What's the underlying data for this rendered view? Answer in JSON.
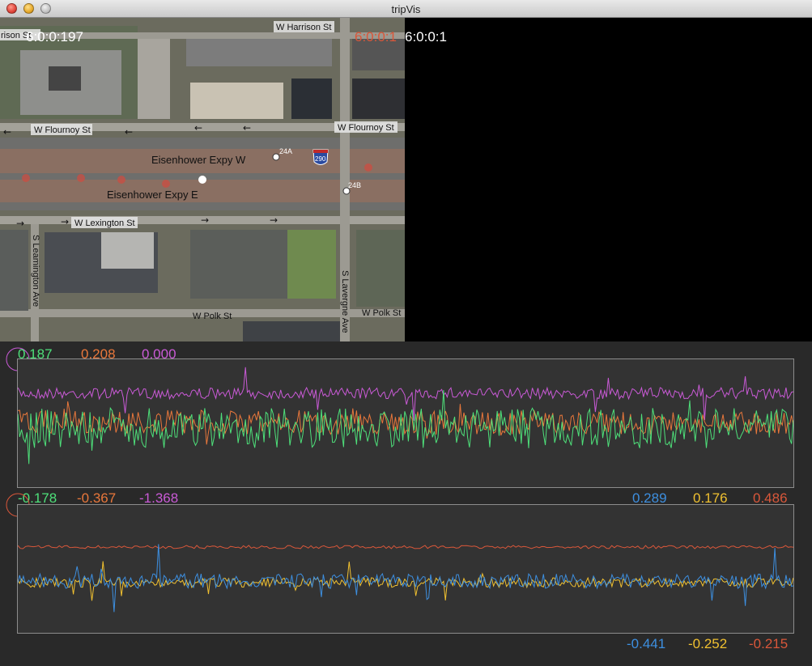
{
  "window": {
    "title": "tripVis"
  },
  "map_overlay": {
    "time_left": "6:0:0:197",
    "time_right_red": "6:0:0:1",
    "time_right_white": "6:0:0:1",
    "streets": {
      "harrison_left": "rison St",
      "harrison": "W Harrison St",
      "flournoy_left": "W Flournoy St",
      "flournoy_right": "W Flournoy St",
      "eisenhower_w": "Eisenhower Expy W",
      "eisenhower_e": "Eisenhower Expy E",
      "lexington": "W Lexington St",
      "leamington": "S Leamington Ave",
      "lavergne": "S Lavergne Ave",
      "polk_left": "W Polk St",
      "polk_right": "W Polk St"
    },
    "exits": {
      "a": "24A",
      "b": "24B"
    },
    "interstate": "290"
  },
  "panel1": {
    "max_values": [
      {
        "label": "0.187",
        "color": "#4ee07a"
      },
      {
        "label": "0.208",
        "color": "#e8773b"
      },
      {
        "label": "0.000",
        "color": "#c95ad6"
      }
    ],
    "min_values": [
      {
        "label": "-0.178",
        "color": "#4ee07a"
      },
      {
        "label": "-0.367",
        "color": "#e8773b"
      },
      {
        "label": "-1.368",
        "color": "#c95ad6"
      }
    ]
  },
  "panel2": {
    "max_values": [
      {
        "label": "0.289",
        "color": "#3d8fe0"
      },
      {
        "label": "0.176",
        "color": "#f0c030"
      },
      {
        "label": "0.486",
        "color": "#d9573a"
      }
    ],
    "min_values": [
      {
        "label": "-0.441",
        "color": "#3d8fe0"
      },
      {
        "label": "-0.252",
        "color": "#f0c030"
      },
      {
        "label": "-0.215",
        "color": "#d9573a"
      }
    ]
  },
  "colors": {
    "green": "#4ee07a",
    "orange": "#e8773b",
    "purple": "#c95ad6",
    "blue": "#3d8fe0",
    "yellow": "#f0c030",
    "red": "#d9573a"
  }
}
